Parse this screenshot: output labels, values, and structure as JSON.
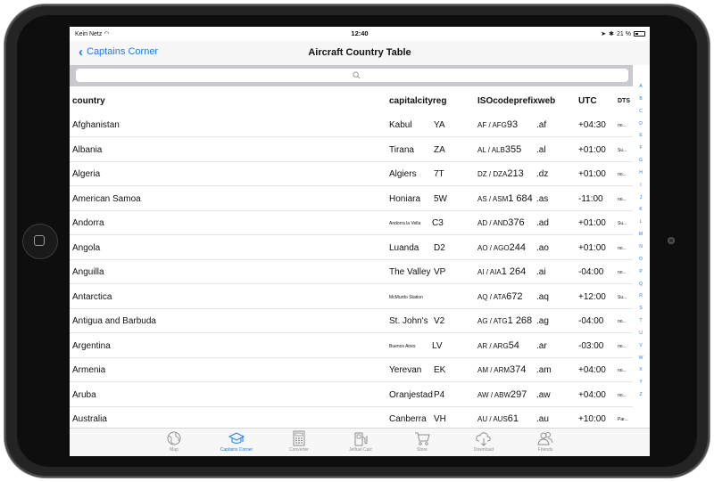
{
  "status_bar": {
    "carrier": "Kein Netz",
    "time": "12:40",
    "battery": "21 %"
  },
  "nav": {
    "back_label": "Captains Corner",
    "title": "Aircraft Country Table"
  },
  "table": {
    "headers": {
      "country": "country",
      "capitalcityreg": "capitalcityreg",
      "isocodeprefixweb": "ISOcodeprefixweb",
      "utc": "UTC",
      "dts": "DTS"
    },
    "rows": [
      {
        "country": "Afghanistan",
        "capital": "Kabul",
        "capital_small": false,
        "reg": "YA",
        "iso": "AF / AFG",
        "num": "93",
        "web": ".af",
        "utc": "+04:30",
        "dts": "no..."
      },
      {
        "country": "Albania",
        "capital": "Tirana",
        "capital_small": false,
        "reg": "ZA",
        "iso": "AL / ALB",
        "num": "355",
        "web": ".al",
        "utc": "+01:00",
        "dts": "Su..."
      },
      {
        "country": "Algeria",
        "capital": "Algiers",
        "capital_small": false,
        "reg": "7T",
        "iso": "DZ / DZA",
        "num": "213",
        "web": ".dz",
        "utc": "+01:00",
        "dts": "no..."
      },
      {
        "country": "American Samoa",
        "capital": "Honiara",
        "capital_small": false,
        "reg": "5W",
        "iso": "AS / ASM",
        "num": "1 684",
        "web": ".as",
        "utc": "-11:00",
        "dts": "no..."
      },
      {
        "country": "Andorra",
        "capital": "Andorra la Vella",
        "capital_small": true,
        "reg": "C3",
        "iso": "AD / AND",
        "num": "376",
        "web": ".ad",
        "utc": "+01:00",
        "dts": "Su..."
      },
      {
        "country": "Angola",
        "capital": "Luanda",
        "capital_small": false,
        "reg": "D2",
        "iso": "AO / AGO",
        "num": "244",
        "web": ".ao",
        "utc": "+01:00",
        "dts": "no..."
      },
      {
        "country": "Anguilla",
        "capital": "The Valley",
        "capital_small": false,
        "reg": "VP",
        "iso": "AI / AIA",
        "num": "1 264",
        "web": ".ai",
        "utc": "-04:00",
        "dts": "no..."
      },
      {
        "country": "Antarctica",
        "capital": "McMurdo Station",
        "capital_small": true,
        "reg": "",
        "iso": "AQ / ATA",
        "num": "672",
        "web": ".aq",
        "utc": "+12:00",
        "dts": "Su..."
      },
      {
        "country": "Antigua and Barbuda",
        "capital": "St. John's",
        "capital_small": false,
        "reg": "V2",
        "iso": "AG / ATG",
        "num": "1 268",
        "web": ".ag",
        "utc": "-04:00",
        "dts": "no..."
      },
      {
        "country": "Argentina",
        "capital": "Buenos Aires",
        "capital_small": true,
        "reg": "LV",
        "iso": "AR / ARG",
        "num": "54",
        "web": ".ar",
        "utc": "-03:00",
        "dts": "no..."
      },
      {
        "country": "Armenia",
        "capital": "Yerevan",
        "capital_small": false,
        "reg": "EK",
        "iso": "AM / ARM",
        "num": "374",
        "web": ".am",
        "utc": "+04:00",
        "dts": "no..."
      },
      {
        "country": "Aruba",
        "capital": "Oranjestad",
        "capital_small": false,
        "reg": "P4",
        "iso": "AW / ABW",
        "num": "297",
        "web": ".aw",
        "utc": "+04:00",
        "dts": "no..."
      },
      {
        "country": "Australia",
        "capital": "Canberra",
        "capital_small": false,
        "reg": "VH",
        "iso": "AU / AUS",
        "num": "61",
        "web": ".au",
        "utc": "+10:00",
        "dts": "Par..."
      }
    ]
  },
  "index_letters": [
    "A",
    "B",
    "C",
    "D",
    "E",
    "F",
    "G",
    "H",
    "I",
    "J",
    "K",
    "L",
    "M",
    "N",
    "O",
    "P",
    "Q",
    "R",
    "S",
    "T",
    "U",
    "V",
    "W",
    "X",
    "Y",
    "Z"
  ],
  "tabs": [
    {
      "label": "Map",
      "icon": "globe-icon",
      "active": false
    },
    {
      "label": "Captains Corner",
      "icon": "graduation-cap-icon",
      "active": true
    },
    {
      "label": "Converter",
      "icon": "calculator-icon",
      "active": false
    },
    {
      "label": "Jetfuel Calc",
      "icon": "fuel-pump-icon",
      "active": false
    },
    {
      "label": "Store",
      "icon": "cart-icon",
      "active": false
    },
    {
      "label": "Download",
      "icon": "cloud-download-icon",
      "active": false
    },
    {
      "label": "Friends",
      "icon": "friends-icon",
      "active": false
    }
  ],
  "colors": {
    "accent": "#1a7bf2",
    "tab_inactive": "#8e8e8e",
    "search_bar": "#c9c9ce"
  }
}
